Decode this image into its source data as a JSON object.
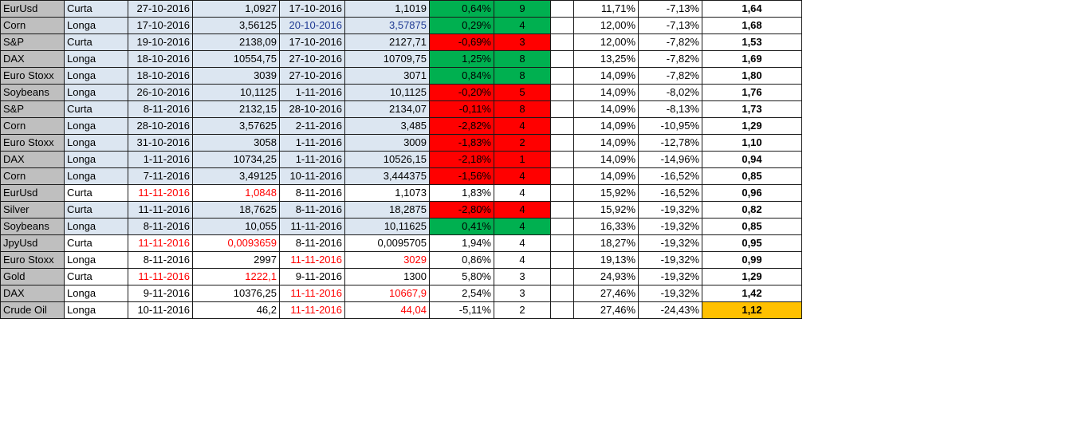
{
  "colors": {
    "positive": "#00b050",
    "negative": "#ff0000",
    "row_fill": "#dce6f1",
    "asset_fill": "#bfbfbf",
    "highlight": "#ffc000",
    "red_text": "#ff0000",
    "blue_text": "#1f3a93"
  },
  "rows": [
    {
      "asset": "EurUsd",
      "dir": "Curta",
      "entry_date": "27-10-2016",
      "entry_price": "1,0927",
      "exit_date": "17-10-2016",
      "exit_price": "1,1019",
      "pct": "0,64%",
      "days": "9",
      "status": "pos",
      "cum_max": "11,71%",
      "cum_min": "-7,13%",
      "ratio": "1,64",
      "plain": false,
      "red_entry": false,
      "red_exit": false,
      "blue_exit": false,
      "highlight": false
    },
    {
      "asset": "Corn",
      "dir": "Longa",
      "entry_date": "17-10-2016",
      "entry_price": "3,56125",
      "exit_date": "20-10-2016",
      "exit_price": "3,57875",
      "pct": "0,29%",
      "days": "4",
      "status": "pos",
      "cum_max": "12,00%",
      "cum_min": "-7,13%",
      "ratio": "1,68",
      "plain": false,
      "red_entry": false,
      "red_exit": false,
      "blue_exit": true,
      "highlight": false
    },
    {
      "asset": "S&P",
      "dir": "Curta",
      "entry_date": "19-10-2016",
      "entry_price": "2138,09",
      "exit_date": "17-10-2016",
      "exit_price": "2127,71",
      "pct": "-0,69%",
      "days": "3",
      "status": "neg",
      "cum_max": "12,00%",
      "cum_min": "-7,82%",
      "ratio": "1,53",
      "plain": false,
      "red_entry": false,
      "red_exit": false,
      "blue_exit": false,
      "highlight": false
    },
    {
      "asset": "DAX",
      "dir": "Longa",
      "entry_date": "18-10-2016",
      "entry_price": "10554,75",
      "exit_date": "27-10-2016",
      "exit_price": "10709,75",
      "pct": "1,25%",
      "days": "8",
      "status": "pos",
      "cum_max": "13,25%",
      "cum_min": "-7,82%",
      "ratio": "1,69",
      "plain": false,
      "red_entry": false,
      "red_exit": false,
      "blue_exit": false,
      "highlight": false
    },
    {
      "asset": "Euro Stoxx",
      "dir": "Longa",
      "entry_date": "18-10-2016",
      "entry_price": "3039",
      "exit_date": "27-10-2016",
      "exit_price": "3071",
      "pct": "0,84%",
      "days": "8",
      "status": "pos",
      "cum_max": "14,09%",
      "cum_min": "-7,82%",
      "ratio": "1,80",
      "plain": false,
      "red_entry": false,
      "red_exit": false,
      "blue_exit": false,
      "highlight": false
    },
    {
      "asset": "Soybeans",
      "dir": "Longa",
      "entry_date": "26-10-2016",
      "entry_price": "10,1125",
      "exit_date": "1-11-2016",
      "exit_price": "10,1125",
      "pct": "-0,20%",
      "days": "5",
      "status": "neg",
      "cum_max": "14,09%",
      "cum_min": "-8,02%",
      "ratio": "1,76",
      "plain": false,
      "red_entry": false,
      "red_exit": false,
      "blue_exit": false,
      "highlight": false
    },
    {
      "asset": "S&P",
      "dir": "Curta",
      "entry_date": "8-11-2016",
      "entry_price": "2132,15",
      "exit_date": "28-10-2016",
      "exit_price": "2134,07",
      "pct": "-0,11%",
      "days": "8",
      "status": "neg",
      "cum_max": "14,09%",
      "cum_min": "-8,13%",
      "ratio": "1,73",
      "plain": false,
      "red_entry": false,
      "red_exit": false,
      "blue_exit": false,
      "highlight": false
    },
    {
      "asset": "Corn",
      "dir": "Longa",
      "entry_date": "28-10-2016",
      "entry_price": "3,57625",
      "exit_date": "2-11-2016",
      "exit_price": "3,485",
      "pct": "-2,82%",
      "days": "4",
      "status": "neg",
      "cum_max": "14,09%",
      "cum_min": "-10,95%",
      "ratio": "1,29",
      "plain": false,
      "red_entry": false,
      "red_exit": false,
      "blue_exit": false,
      "highlight": false
    },
    {
      "asset": "Euro Stoxx",
      "dir": "Longa",
      "entry_date": "31-10-2016",
      "entry_price": "3058",
      "exit_date": "1-11-2016",
      "exit_price": "3009",
      "pct": "-1,83%",
      "days": "2",
      "status": "neg",
      "cum_max": "14,09%",
      "cum_min": "-12,78%",
      "ratio": "1,10",
      "plain": false,
      "red_entry": false,
      "red_exit": false,
      "blue_exit": false,
      "highlight": false
    },
    {
      "asset": "DAX",
      "dir": "Longa",
      "entry_date": "1-11-2016",
      "entry_price": "10734,25",
      "exit_date": "1-11-2016",
      "exit_price": "10526,15",
      "pct": "-2,18%",
      "days": "1",
      "status": "neg",
      "cum_max": "14,09%",
      "cum_min": "-14,96%",
      "ratio": "0,94",
      "plain": false,
      "red_entry": false,
      "red_exit": false,
      "blue_exit": false,
      "highlight": false
    },
    {
      "asset": "Corn",
      "dir": "Longa",
      "entry_date": "7-11-2016",
      "entry_price": "3,49125",
      "exit_date": "10-11-2016",
      "exit_price": "3,444375",
      "pct": "-1,56%",
      "days": "4",
      "status": "neg",
      "cum_max": "14,09%",
      "cum_min": "-16,52%",
      "ratio": "0,85",
      "plain": false,
      "red_entry": false,
      "red_exit": false,
      "blue_exit": false,
      "highlight": false
    },
    {
      "asset": "EurUsd",
      "dir": "Curta",
      "entry_date": "11-11-2016",
      "entry_price": "1,0848",
      "exit_date": "8-11-2016",
      "exit_price": "1,1073",
      "pct": "1,83%",
      "days": "4",
      "status": "neutral",
      "cum_max": "15,92%",
      "cum_min": "-16,52%",
      "ratio": "0,96",
      "plain": true,
      "red_entry": true,
      "red_exit": false,
      "blue_exit": false,
      "highlight": false
    },
    {
      "asset": "Silver",
      "dir": "Curta",
      "entry_date": "11-11-2016",
      "entry_price": "18,7625",
      "exit_date": "8-11-2016",
      "exit_price": "18,2875",
      "pct": "-2,80%",
      "days": "4",
      "status": "neg",
      "cum_max": "15,92%",
      "cum_min": "-19,32%",
      "ratio": "0,82",
      "plain": false,
      "red_entry": false,
      "red_exit": false,
      "blue_exit": false,
      "highlight": false
    },
    {
      "asset": "Soybeans",
      "dir": "Longa",
      "entry_date": "8-11-2016",
      "entry_price": "10,055",
      "exit_date": "11-11-2016",
      "exit_price": "10,11625",
      "pct": "0,41%",
      "days": "4",
      "status": "pos",
      "cum_max": "16,33%",
      "cum_min": "-19,32%",
      "ratio": "0,85",
      "plain": false,
      "red_entry": false,
      "red_exit": false,
      "blue_exit": false,
      "highlight": false
    },
    {
      "asset": "JpyUsd",
      "dir": "Curta",
      "entry_date": "11-11-2016",
      "entry_price": "0,0093659",
      "exit_date": "8-11-2016",
      "exit_price": "0,0095705",
      "pct": "1,94%",
      "days": "4",
      "status": "neutral",
      "cum_max": "18,27%",
      "cum_min": "-19,32%",
      "ratio": "0,95",
      "plain": true,
      "red_entry": true,
      "red_exit": false,
      "blue_exit": false,
      "highlight": false
    },
    {
      "asset": "Euro Stoxx",
      "dir": "Longa",
      "entry_date": "8-11-2016",
      "entry_price": "2997",
      "exit_date": "11-11-2016",
      "exit_price": "3029",
      "pct": "0,86%",
      "days": "4",
      "status": "neutral",
      "cum_max": "19,13%",
      "cum_min": "-19,32%",
      "ratio": "0,99",
      "plain": true,
      "red_entry": false,
      "red_exit": true,
      "blue_exit": false,
      "highlight": false
    },
    {
      "asset": "Gold",
      "dir": "Curta",
      "entry_date": "11-11-2016",
      "entry_price": "1222,1",
      "exit_date": "9-11-2016",
      "exit_price": "1300",
      "pct": "5,80%",
      "days": "3",
      "status": "neutral",
      "cum_max": "24,93%",
      "cum_min": "-19,32%",
      "ratio": "1,29",
      "plain": true,
      "red_entry": true,
      "red_exit": false,
      "blue_exit": false,
      "highlight": false
    },
    {
      "asset": "DAX",
      "dir": "Longa",
      "entry_date": "9-11-2016",
      "entry_price": "10376,25",
      "exit_date": "11-11-2016",
      "exit_price": "10667,9",
      "pct": "2,54%",
      "days": "3",
      "status": "neutral",
      "cum_max": "27,46%",
      "cum_min": "-19,32%",
      "ratio": "1,42",
      "plain": true,
      "red_entry": false,
      "red_exit": true,
      "blue_exit": false,
      "highlight": false
    },
    {
      "asset": "Crude Oil",
      "dir": "Longa",
      "entry_date": "10-11-2016",
      "entry_price": "46,2",
      "exit_date": "11-11-2016",
      "exit_price": "44,04",
      "pct": "-5,11%",
      "days": "2",
      "status": "neutral",
      "cum_max": "27,46%",
      "cum_min": "-24,43%",
      "ratio": "1,12",
      "plain": true,
      "red_entry": false,
      "red_exit": true,
      "blue_exit": false,
      "highlight": true
    }
  ]
}
